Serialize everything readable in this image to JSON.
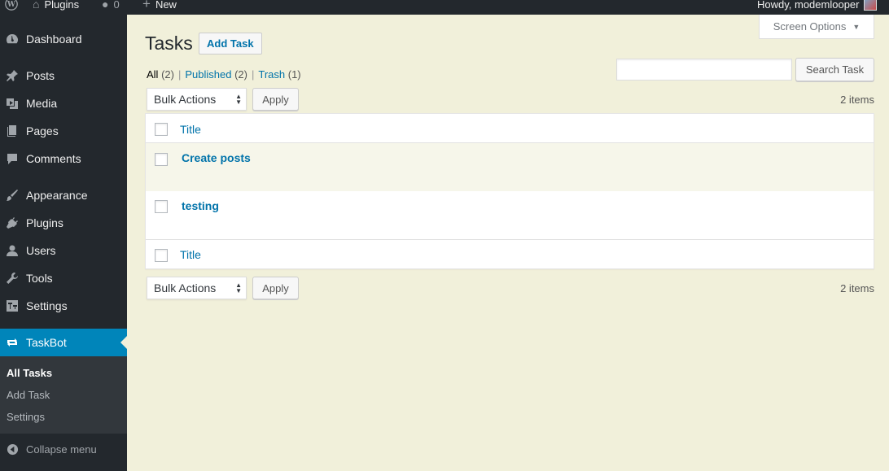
{
  "adminbar": {
    "plugins_label": "Plugins",
    "comments_count": "0",
    "new_label": "New",
    "greeting": "Howdy, modemlooper"
  },
  "sidebar": {
    "items": [
      {
        "label": "Dashboard",
        "icon": "dashboard-icon"
      },
      {
        "label": "Posts",
        "icon": "pin-icon"
      },
      {
        "label": "Media",
        "icon": "media-icon"
      },
      {
        "label": "Pages",
        "icon": "pages-icon"
      },
      {
        "label": "Comments",
        "icon": "comment-icon"
      },
      {
        "label": "Appearance",
        "icon": "brush-icon"
      },
      {
        "label": "Plugins",
        "icon": "plugin-icon"
      },
      {
        "label": "Users",
        "icon": "user-icon"
      },
      {
        "label": "Tools",
        "icon": "wrench-icon"
      },
      {
        "label": "Settings",
        "icon": "settings-icon"
      },
      {
        "label": "TaskBot",
        "icon": "repeat-icon"
      }
    ],
    "submenu": [
      "All Tasks",
      "Add Task",
      "Settings"
    ],
    "collapse_label": "Collapse menu"
  },
  "main": {
    "screen_options": "Screen Options",
    "title": "Tasks",
    "add_task": "Add Task",
    "views": {
      "all": "All",
      "all_count": "(2)",
      "published": "Published",
      "published_count": "(2)",
      "trash": "Trash",
      "trash_count": "(1)"
    },
    "search_button": "Search Task",
    "bulk_actions": "Bulk Actions",
    "apply": "Apply",
    "items_count": "2 items",
    "column_title": "Title",
    "rows": [
      "Create posts",
      "testing"
    ]
  },
  "colors": {
    "adminbar": "#23282d",
    "sidebar": "#23282d",
    "submenu": "#32373c",
    "active_menu": "#0085ba",
    "background": "#f1f0da",
    "link": "#0073aa"
  }
}
